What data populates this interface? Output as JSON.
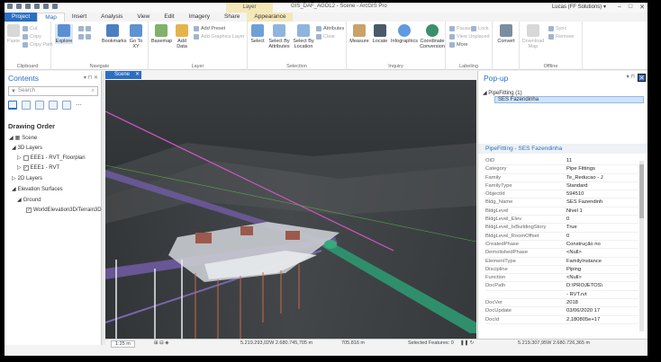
{
  "title_bar": {
    "context_tab": "Layer",
    "doc_title": "GIS_DAF_AGOL2 - Scene - ArcGIS Pro",
    "user": "Lucas (FF Solutions) ▾",
    "min": "–",
    "max": "□",
    "close": "✕"
  },
  "tabs": [
    "Project",
    "Map",
    "Insert",
    "Analysis",
    "View",
    "Edit",
    "Imagery",
    "Share",
    "Appearance"
  ],
  "ribbon": {
    "clipboard": {
      "paste": "Paste",
      "cut": "Cut",
      "copy": "Copy",
      "copy_path": "Copy Path",
      "label": "Clipboard"
    },
    "navigate": {
      "explore": "Explore",
      "bookmarks": "Bookmarks",
      "goto": "Go To XY",
      "label": "Navigate"
    },
    "layer": {
      "basemap": "Basemap",
      "add_data": "Add Data",
      "add_preset": "Add Preset",
      "add_graphics": "Add Graphics Layer",
      "label": "Layer"
    },
    "selection": {
      "select": "Select",
      "by_attr": "Select By Attributes",
      "by_loc": "Select By Location",
      "attributes": "Attributes",
      "clear": "Clear",
      "label": "Selection"
    },
    "inquiry": {
      "measure": "Measure",
      "locate": "Locate",
      "infographics": "Infographics",
      "coord": "Coordinate Conversion",
      "label": "Inquiry"
    },
    "labeling": {
      "pause": "Pause",
      "lock": "Lock",
      "view_unplaced": "View Unplaced",
      "more": "More",
      "label": "Labeling"
    },
    "convert": {
      "convert": "Convert",
      "label": ""
    },
    "offline": {
      "download": "Download Map",
      "sync": "Sync",
      "remove": "Remove",
      "label": "Offline"
    }
  },
  "contents": {
    "title": "Contents",
    "search_placeholder": "Search",
    "drawing_order": "Drawing Order",
    "scene": "Scene",
    "layers_3d": "3D Layers",
    "layer1": "EEE1 - RVT_Floorplan",
    "layer2": "EEE1 - RVT",
    "layers_2d": "2D Layers",
    "elevation": "Elevation Surfaces",
    "ground": "Ground",
    "world_elev": "WorldElevation3D/Terrain3D"
  },
  "scene_tab": "Scene",
  "status": {
    "scale": "1:25 m",
    "coords": "5.219.293,02W 2.680.745,705 m",
    "elev": "705.816 m",
    "selected": "Selected Features: 0",
    "coords2": "5.219.307,95W 2.680.726,365 m"
  },
  "popup": {
    "title": "Pop-up",
    "node": "PipeFitting  (1)",
    "selected_feature": "SES Fazendinha",
    "header": "PipeFitting - SES Fazendinha",
    "attributes": [
      {
        "k": "OID",
        "v": "11"
      },
      {
        "k": "Category",
        "v": "Pipe Fittings"
      },
      {
        "k": "Family",
        "v": "Te_Reducao - J"
      },
      {
        "k": "FamilyType",
        "v": "Standard"
      },
      {
        "k": "ObjectId",
        "v": "594510"
      },
      {
        "k": "Bldg_Name",
        "v": "SES Fazendinh"
      },
      {
        "k": "BldgLevel",
        "v": "Nivel 1"
      },
      {
        "k": "BldgLevel_Elev",
        "v": "0"
      },
      {
        "k": "BldgLevel_IsBuildingStory",
        "v": "True"
      },
      {
        "k": "BldgLevel_RoomOffset",
        "v": "0"
      },
      {
        "k": "CreatedPhase",
        "v": "Construção no"
      },
      {
        "k": "DemolishedPhase",
        "v": "<Null>"
      },
      {
        "k": "ElementType",
        "v": "FamilyInstance"
      },
      {
        "k": "Discipline",
        "v": "Piping"
      },
      {
        "k": "Function",
        "v": "<Null>"
      },
      {
        "k": "DocPath",
        "v": "D:\\PROJETOS\\"
      },
      {
        "k": "",
        "v": "- RVT.rvt"
      },
      {
        "k": "DocVer",
        "v": "2018"
      },
      {
        "k": "DocUpdate",
        "v": "03/06/2020 17"
      },
      {
        "k": "DocId",
        "v": "2,180805e+17"
      }
    ]
  },
  "colors": {
    "accent": "#2a6fc2",
    "context_tab": "#f4e7b8"
  }
}
